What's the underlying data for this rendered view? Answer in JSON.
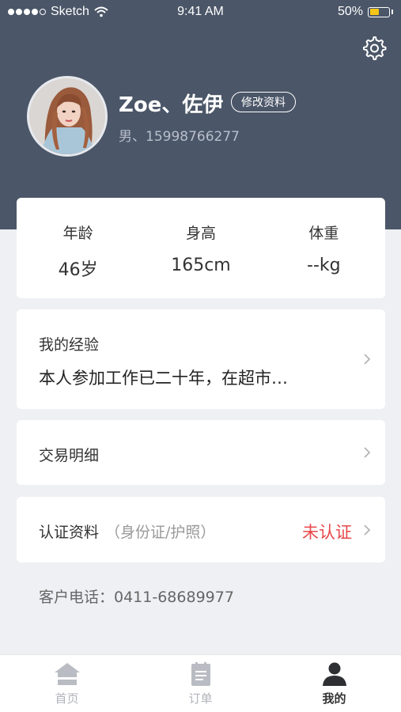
{
  "status_bar": {
    "carrier": "Sketch",
    "time": "9:41 AM",
    "battery_percent": "50%",
    "battery_level": 0.5
  },
  "profile": {
    "name": "Zoe、佐伊",
    "edit_label": "修改资料",
    "sub_info": "男、15998766277"
  },
  "stats": [
    {
      "label": "年龄",
      "value": "46岁"
    },
    {
      "label": "身高",
      "value": "165cm"
    },
    {
      "label": "体重",
      "value": "--kg"
    }
  ],
  "experience": {
    "title": "我的经验",
    "text": "本人参加工作已二十年，在超市…"
  },
  "trade": {
    "label": "交易明细"
  },
  "certification": {
    "label": "认证资料",
    "hint": "（身份证/护照）",
    "status": "未认证"
  },
  "contact": {
    "phone_text": "客户电话：0411-68689977"
  },
  "tabbar": {
    "tabs": [
      {
        "label": "首页",
        "icon": "home-icon",
        "active": false
      },
      {
        "label": "订单",
        "icon": "order-icon",
        "active": false
      },
      {
        "label": "我的",
        "icon": "user-icon",
        "active": true
      }
    ]
  },
  "colors": {
    "header": "#4b5668",
    "background": "#eef0f4",
    "alert": "#e8484a",
    "battery": "#f5c518"
  }
}
